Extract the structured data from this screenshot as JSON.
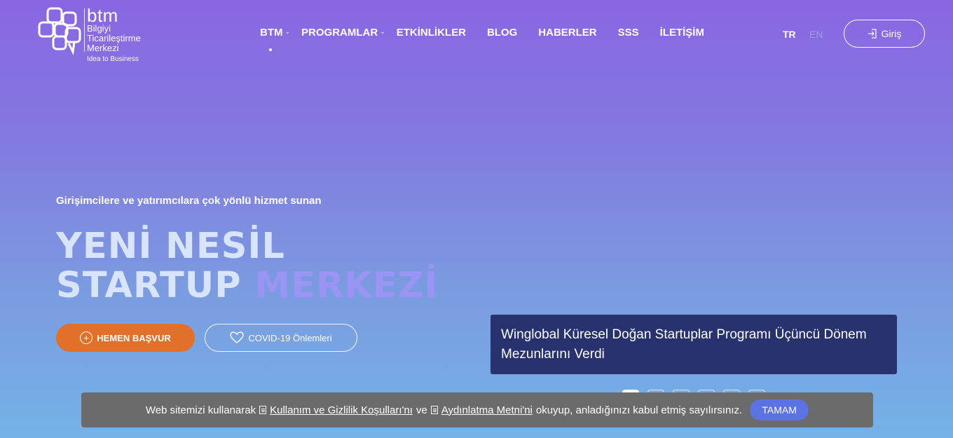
{
  "logo": {
    "brand": "btm",
    "line1": "Bilgiyi",
    "line2": "Ticarileştirme",
    "line3": "Merkezi",
    "tagline": "Idea to Business"
  },
  "nav": {
    "items": [
      {
        "label": "BTM",
        "has_dropdown": true,
        "active": true
      },
      {
        "label": "PROGRAMLAR",
        "has_dropdown": true
      },
      {
        "label": "ETKİNLİKLER"
      },
      {
        "label": "BLOG"
      },
      {
        "label": "HABERLER"
      },
      {
        "label": "SSS"
      },
      {
        "label": "İLETİŞİM"
      }
    ]
  },
  "language": {
    "tr": "TR",
    "en": "EN",
    "selected": "TR"
  },
  "login": {
    "label": "Giriş",
    "icon": "login-icon"
  },
  "hero": {
    "subtitle": "Girişimcilere ve yatırımcılara çok yönlü hizmet sunan",
    "title_line1": "YENİ NESİL",
    "title_line2_a": "STARTUP ",
    "title_line2_b": "MERKEZİ",
    "apply_label": "HEMEN BAŞVUR",
    "covid_label": "COVID-19 Önlemleri"
  },
  "news": {
    "headline": "Winglobal Küresel Doğan Startuplar Programı Üçüncü Dönem Mezunlarını Verdi",
    "slide_count": 6,
    "active_slide": 1
  },
  "cookie": {
    "text_before": "Web sitemizi kullanarak",
    "link1": "Kullanım ve Gizlilik Koşulları'nı",
    "text_mid": "ve",
    "link2": "Aydınlatma Metni'ni",
    "text_after": "okuyup, anladığınızı kabul etmiş sayılırsınız.",
    "button": "TAMAM"
  },
  "colors": {
    "bg_top": "#8a66e2",
    "bg_bottom": "#74b2e6",
    "apply_button": "#e0702a",
    "news_card": "#27326f",
    "cookie_bar": "#6b6b6b",
    "cookie_button": "#5b73e0"
  }
}
